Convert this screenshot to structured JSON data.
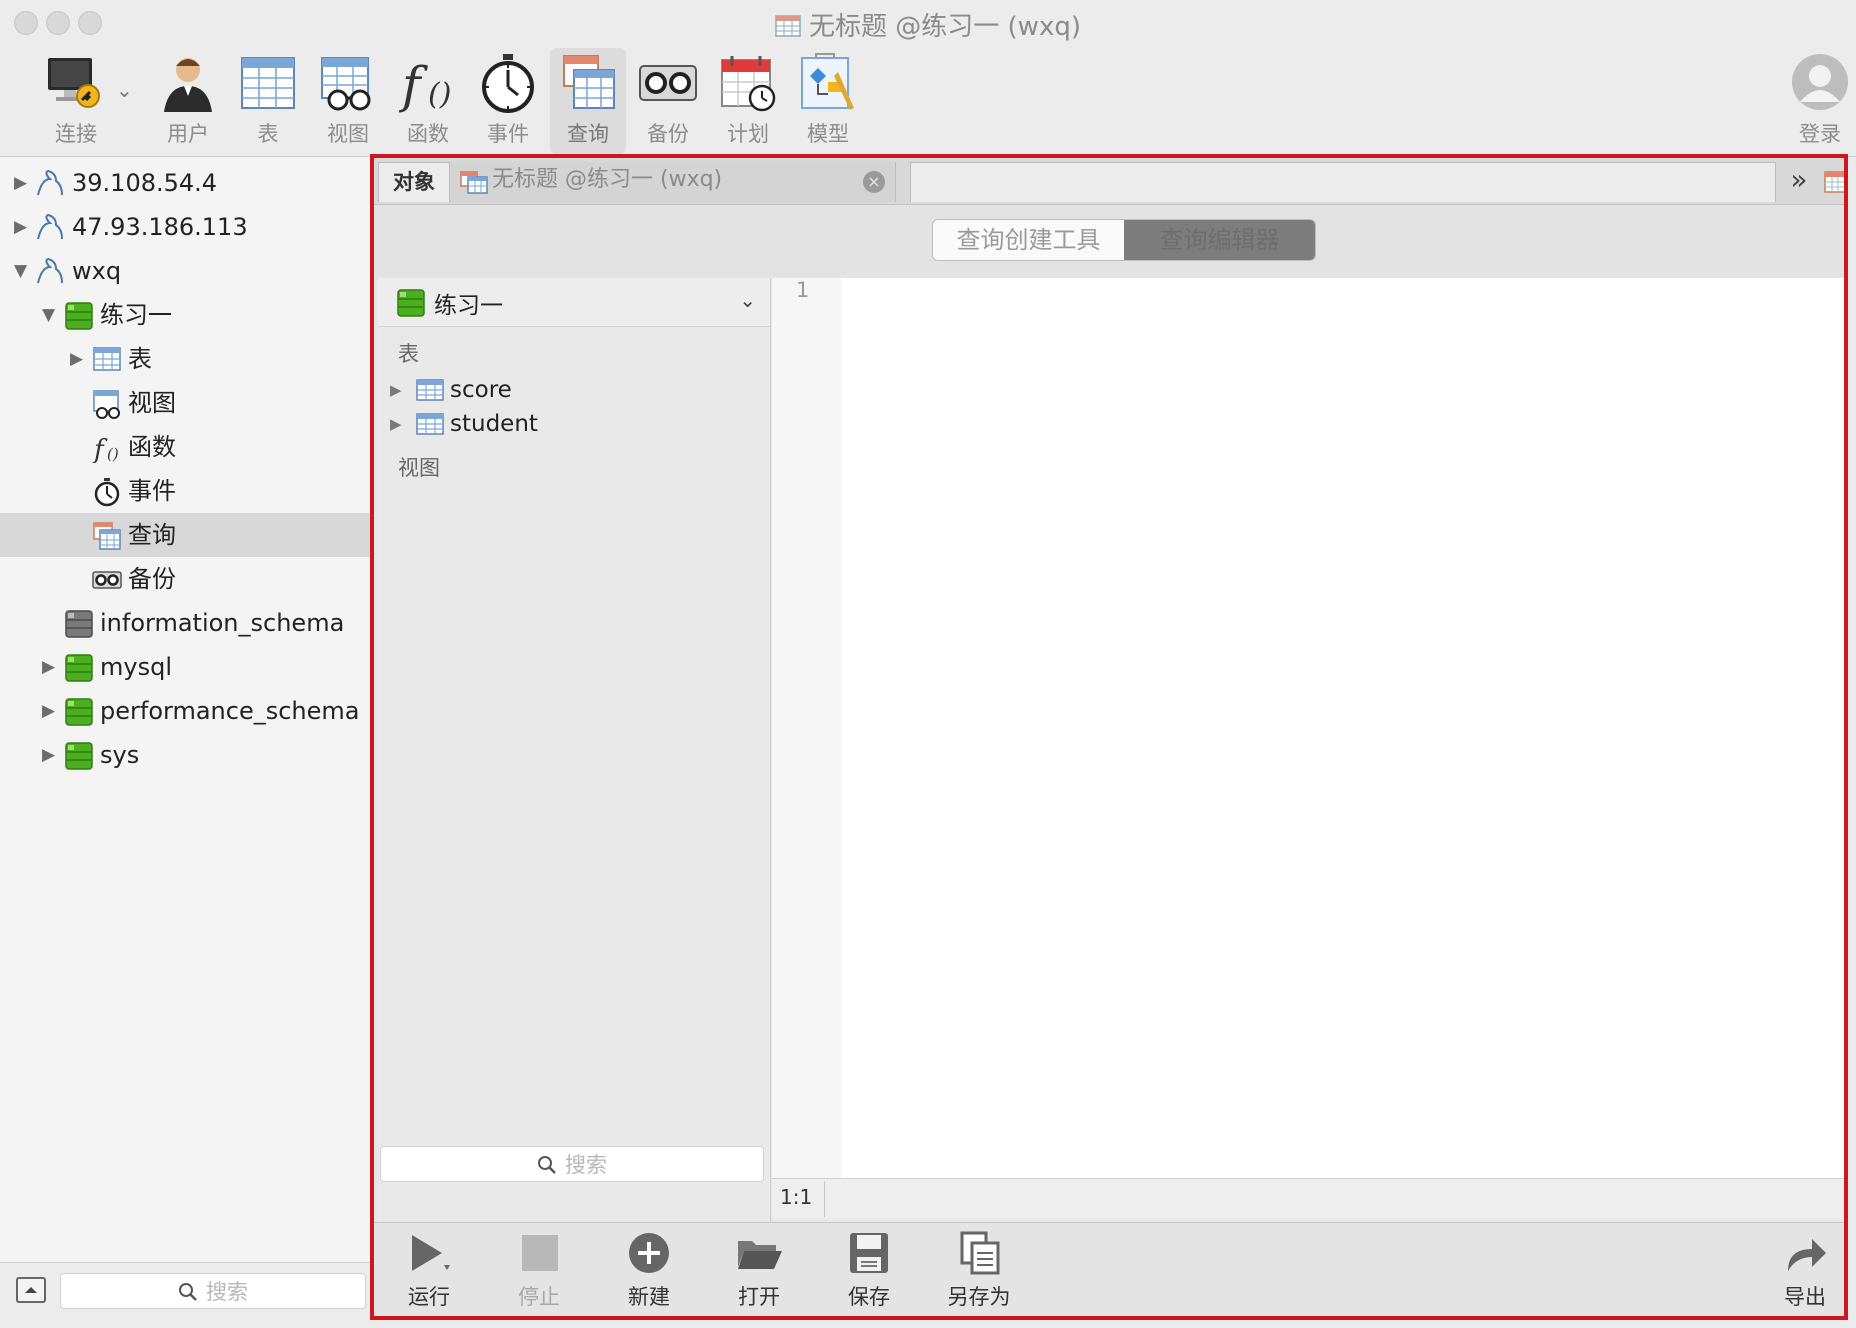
{
  "window": {
    "title": "无标题 @练习一 (wxq)"
  },
  "toolbar": {
    "connect": "连接",
    "user": "用户",
    "table": "表",
    "view": "视图",
    "function": "函数",
    "event": "事件",
    "query": "查询",
    "backup": "备份",
    "schedule": "计划",
    "model": "模型",
    "login": "登录"
  },
  "sidebar": {
    "tree": [
      {
        "label": "39.108.54.4",
        "icon": "connection-icon",
        "expanded": false
      },
      {
        "label": "47.93.186.113",
        "icon": "connection-icon",
        "expanded": false
      },
      {
        "label": "wxq",
        "icon": "connection-icon",
        "expanded": true
      },
      {
        "label": "练习一",
        "icon": "database-icon",
        "expanded": true
      },
      {
        "label": "表",
        "icon": "table-icon",
        "expanded": false
      },
      {
        "label": "视图",
        "icon": "view-icon"
      },
      {
        "label": "函数",
        "icon": "function-icon"
      },
      {
        "label": "事件",
        "icon": "event-icon"
      },
      {
        "label": "查询",
        "icon": "query-icon",
        "selected": true
      },
      {
        "label": "备份",
        "icon": "backup-icon"
      },
      {
        "label": "information_schema",
        "icon": "database-gray-icon"
      },
      {
        "label": "mysql",
        "icon": "database-icon",
        "expanded": false
      },
      {
        "label": "performance_schema",
        "icon": "database-icon",
        "expanded": false
      },
      {
        "label": "sys",
        "icon": "database-icon",
        "expanded": false
      }
    ],
    "search_placeholder": "搜索"
  },
  "tabs": {
    "objects": "对象",
    "query_tab": "无标题 @练习一 (wxq)",
    "close": "×",
    "more": "»"
  },
  "mode": {
    "builder": "查询创建工具",
    "editor": "查询编辑器"
  },
  "objects_panel": {
    "database": "练习一",
    "tables_header": "表",
    "tables": [
      "score",
      "student"
    ],
    "views_header": "视图",
    "search_placeholder": "搜索"
  },
  "editor": {
    "line_number": "1",
    "cursor": "1:1"
  },
  "bottom_toolbar": {
    "run": "运行",
    "stop": "停止",
    "new": "新建",
    "open": "打开",
    "save": "保存",
    "save_as": "另存为",
    "export": "导出"
  },
  "colors": {
    "highlight_frame": "#d0151c",
    "database_green": "#4caf1f"
  }
}
